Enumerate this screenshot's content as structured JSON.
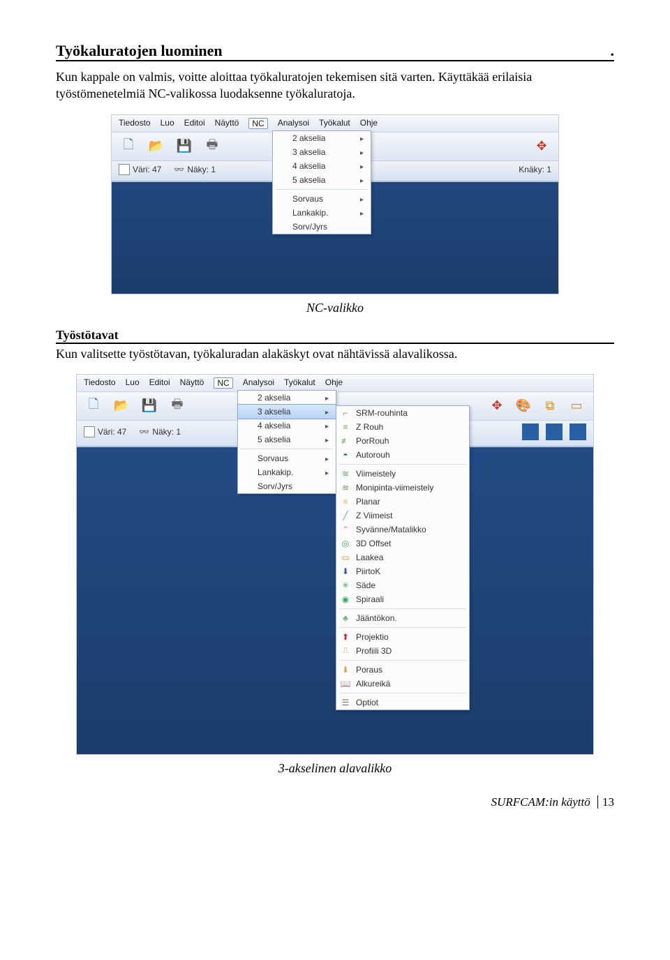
{
  "heading": {
    "title": "Työkaluratojen luominen",
    "dot": "."
  },
  "intro": "Kun kappale on valmis, voitte aloittaa työkaluratojen tekemisen sitä varten. Käyttäkää erilaisia työstömenetelmiä NC-valikossa luodaksenne työkaluratoja.",
  "menubar": [
    "Tiedosto",
    "Luo",
    "Editoi",
    "Näyttö",
    "NC",
    "Analysoi",
    "Työkalut",
    "Ohje"
  ],
  "toolbar2": {
    "vari_label": "Väri: 47",
    "naky_label": "Näky: 1",
    "knaky_label": "Knäky: 1"
  },
  "nc_menu": {
    "items": [
      {
        "label": "2 akselia",
        "arrow": true
      },
      {
        "label": "3 akselia",
        "arrow": true
      },
      {
        "label": "4 akselia",
        "arrow": true
      },
      {
        "label": "5 akselia",
        "arrow": true
      }
    ],
    "items2": [
      {
        "label": "Sorvaus",
        "arrow": true
      },
      {
        "label": "Lankakip.",
        "arrow": true
      },
      {
        "label": "Sorv/Jyrs",
        "arrow": false
      }
    ]
  },
  "caption1": "NC-valikko",
  "sub_heading": "Työstötavat",
  "para2": "Kun valitsette työstötavan, työkaluradan alakäskyt ovat nähtävissä alavalikossa.",
  "submenu3": [
    "SRM-rouhinta",
    "Z Rouh",
    "PorRouh",
    "Autorouh",
    "Viimeistely",
    "Monipinta-viimeistely",
    "Planar",
    "Z Viimeist",
    "Syvänne/Matalikko",
    "3D Offset",
    "Laakea",
    "PiirtoK",
    "Säde",
    "Spiraali",
    "Jääntökon.",
    "Projektio",
    "Profiili 3D",
    "Poraus",
    "Alkureikä",
    "Optiot"
  ],
  "caption2": "3-akselinen alavalikko",
  "footer": {
    "doc": "SURFCAM:in käyttö",
    "page": "13"
  }
}
